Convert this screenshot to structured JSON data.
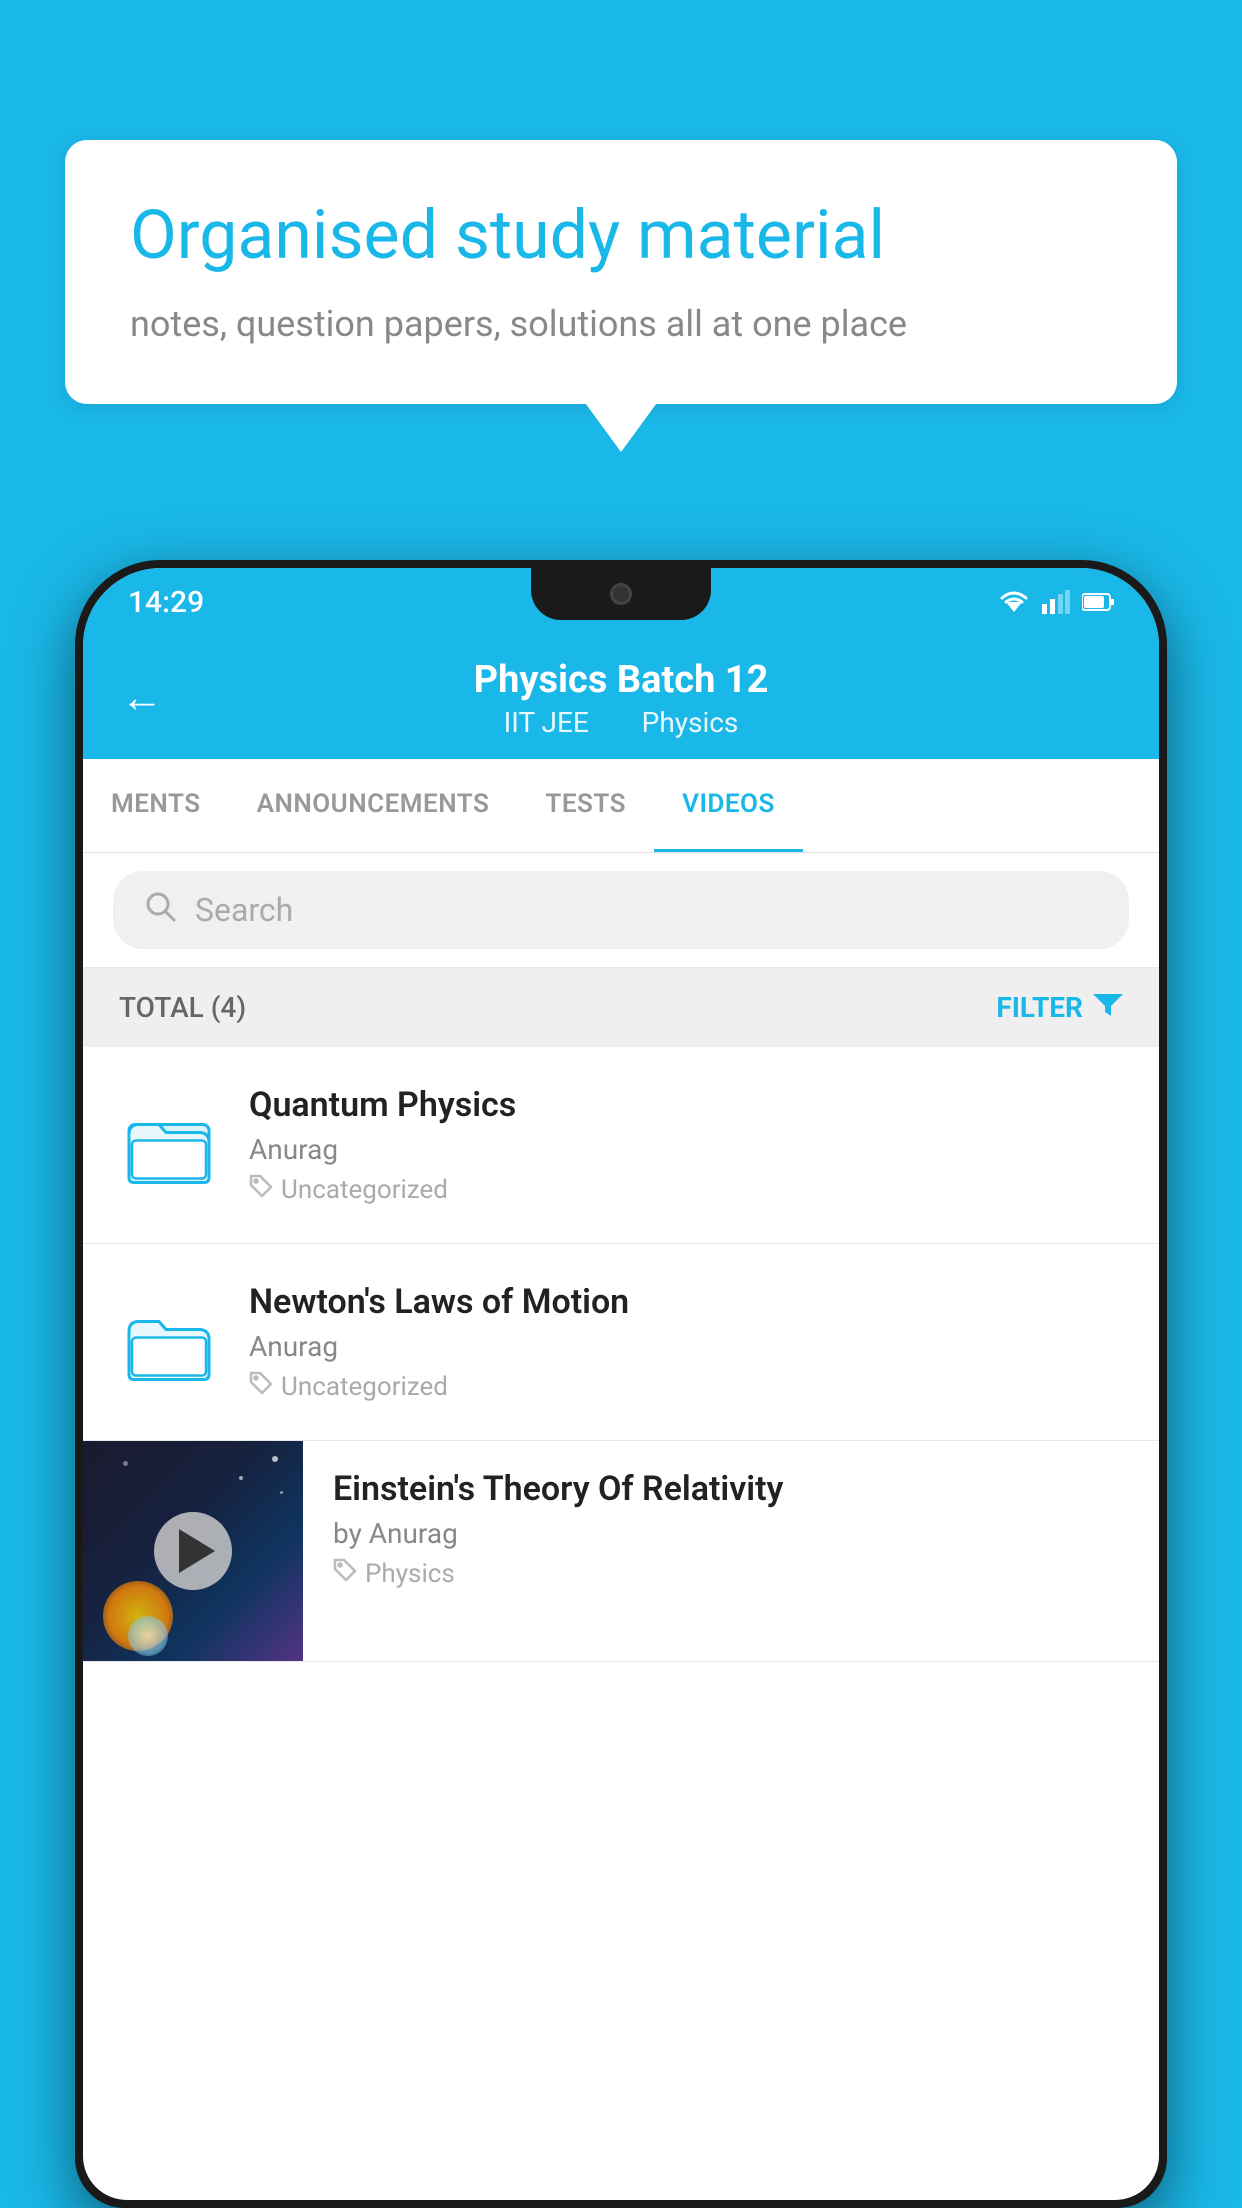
{
  "background_color": "#1ab8e8",
  "speech_bubble": {
    "title": "Organised study material",
    "subtitle": "notes, question papers, solutions all at one place"
  },
  "status_bar": {
    "time": "14:29"
  },
  "header": {
    "title": "Physics Batch 12",
    "subtitle_1": "IIT JEE",
    "subtitle_2": "Physics",
    "back_label": "←"
  },
  "tabs": [
    {
      "label": "MENTS",
      "active": false
    },
    {
      "label": "ANNOUNCEMENTS",
      "active": false
    },
    {
      "label": "TESTS",
      "active": false
    },
    {
      "label": "VIDEOS",
      "active": true
    }
  ],
  "search": {
    "placeholder": "Search"
  },
  "filter": {
    "total_label": "TOTAL (4)",
    "filter_label": "FILTER"
  },
  "videos": [
    {
      "title": "Quantum Physics",
      "author": "Anurag",
      "tag": "Uncategorized",
      "type": "folder"
    },
    {
      "title": "Newton's Laws of Motion",
      "author": "Anurag",
      "tag": "Uncategorized",
      "type": "folder"
    },
    {
      "title": "Einstein's Theory Of Relativity",
      "author": "by Anurag",
      "tag": "Physics",
      "type": "video"
    }
  ]
}
